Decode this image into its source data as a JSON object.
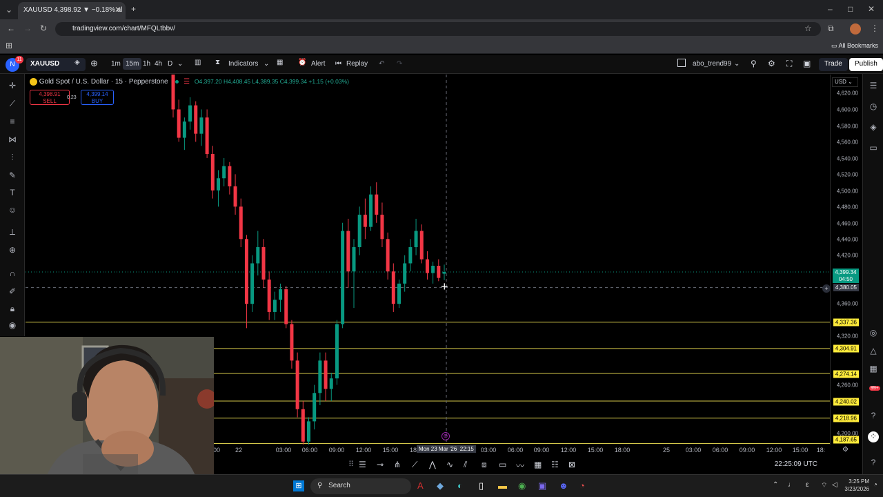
{
  "browser": {
    "tab_title": "XAUUSD 4,398.92 ▼ −0.18% al",
    "url": "tradingview.com/chart/MFQLtbbv/",
    "bookmarks_label": "All Bookmarks"
  },
  "toolbar": {
    "avatar_letter": "N",
    "notif_count": "11",
    "symbol": "XAUUSD",
    "intervals": [
      "1m",
      "15m",
      "1h",
      "4h",
      "D"
    ],
    "active_interval": "15m",
    "indicators_label": "Indicators",
    "alert_label": "Alert",
    "replay_label": "Replay",
    "layout_name": "abo_trend99",
    "trade_label": "Trade",
    "publish_label": "Publish"
  },
  "legend": {
    "title": "Gold Spot / U.S. Dollar · 15 · Pepperstone",
    "open": "O4,397.20",
    "high": "H4,408.45",
    "low": "L4,389.35",
    "close": "C4,399.34",
    "change": "+1.15 (+0.03%)",
    "sell_price": "4,398.91",
    "sell_label": "SELL",
    "spread": "0.23",
    "buy_price": "4,399.14",
    "buy_label": "BUY"
  },
  "price_axis": {
    "currency": "USD",
    "ticks": [
      "4,620.00",
      "4,600.00",
      "4,580.00",
      "4,560.00",
      "4,540.00",
      "4,520.00",
      "4,500.00",
      "4,480.00",
      "4,460.00",
      "4,440.00",
      "4,420.00",
      "4,360.00",
      "4,320.00",
      "4,260.00",
      "4,200.00"
    ],
    "current_price": "4,399.34",
    "countdown": "04:50",
    "crosshair_price": "4,380.05",
    "levels": [
      "4,337.36",
      "4,304.91",
      "4,274.14",
      "4,240.02",
      "4,218.96",
      "4,187.65"
    ]
  },
  "time_axis": {
    "labels": [
      "00",
      "22",
      "03:00",
      "06:00",
      "09:00",
      "12:00",
      "15:00",
      "18",
      "22:15",
      "03:00",
      "06:00",
      "09:00",
      "12:00",
      "15:00",
      "18:00",
      "25",
      "03:00",
      "06:00",
      "09:00",
      "12:00",
      "15:00",
      "18:"
    ],
    "crosshair_date": "Mon 23 Mar '26",
    "clock": "22:25:09 UTC"
  },
  "taskbar": {
    "search_label": "Search",
    "time": "3:25 PM",
    "date": "3/23/2026",
    "badge": "99+"
  },
  "chart_data": {
    "type": "candlestick",
    "symbol": "XAUUSD",
    "interval": "15",
    "ylim": [
      4180,
      4630
    ],
    "horizontal_levels": [
      4337.36,
      4304.91,
      4274.14,
      4240.02,
      4218.96,
      4187.65
    ],
    "last_price": 4399.34,
    "crosshair_price": 4380.05,
    "candles": [
      {
        "o": 4650,
        "h": 4655,
        "l": 4590,
        "c": 4600
      },
      {
        "o": 4600,
        "h": 4612,
        "l": 4560,
        "c": 4565
      },
      {
        "o": 4565,
        "h": 4590,
        "l": 4550,
        "c": 4585
      },
      {
        "o": 4585,
        "h": 4615,
        "l": 4575,
        "c": 4605
      },
      {
        "o": 4605,
        "h": 4610,
        "l": 4560,
        "c": 4570
      },
      {
        "o": 4570,
        "h": 4600,
        "l": 4555,
        "c": 4590
      },
      {
        "o": 4590,
        "h": 4600,
        "l": 4540,
        "c": 4545
      },
      {
        "o": 4545,
        "h": 4555,
        "l": 4490,
        "c": 4500
      },
      {
        "o": 4500,
        "h": 4525,
        "l": 4480,
        "c": 4515
      },
      {
        "o": 4515,
        "h": 4540,
        "l": 4505,
        "c": 4530
      },
      {
        "o": 4530,
        "h": 4535,
        "l": 4495,
        "c": 4505
      },
      {
        "o": 4505,
        "h": 4520,
        "l": 4470,
        "c": 4480
      },
      {
        "o": 4480,
        "h": 4490,
        "l": 4430,
        "c": 4440
      },
      {
        "o": 4440,
        "h": 4445,
        "l": 4330,
        "c": 4360
      },
      {
        "o": 4360,
        "h": 4420,
        "l": 4350,
        "c": 4410
      },
      {
        "o": 4410,
        "h": 4450,
        "l": 4395,
        "c": 4430
      },
      {
        "o": 4430,
        "h": 4440,
        "l": 4380,
        "c": 4390
      },
      {
        "o": 4390,
        "h": 4400,
        "l": 4340,
        "c": 4350
      },
      {
        "o": 4350,
        "h": 4375,
        "l": 4340,
        "c": 4365
      },
      {
        "o": 4365,
        "h": 4385,
        "l": 4350,
        "c": 4378
      },
      {
        "o": 4378,
        "h": 4382,
        "l": 4330,
        "c": 4335
      },
      {
        "o": 4335,
        "h": 4340,
        "l": 4280,
        "c": 4290
      },
      {
        "o": 4290,
        "h": 4300,
        "l": 4220,
        "c": 4230
      },
      {
        "o": 4230,
        "h": 4240,
        "l": 4180,
        "c": 4190
      },
      {
        "o": 4190,
        "h": 4220,
        "l": 4180,
        "c": 4215
      },
      {
        "o": 4215,
        "h": 4260,
        "l": 4205,
        "c": 4250
      },
      {
        "o": 4250,
        "h": 4300,
        "l": 4235,
        "c": 4290
      },
      {
        "o": 4290,
        "h": 4300,
        "l": 4240,
        "c": 4255
      },
      {
        "o": 4255,
        "h": 4275,
        "l": 4240,
        "c": 4268
      },
      {
        "o": 4268,
        "h": 4340,
        "l": 4260,
        "c": 4335
      },
      {
        "o": 4335,
        "h": 4460,
        "l": 4330,
        "c": 4450
      },
      {
        "o": 4450,
        "h": 4465,
        "l": 4380,
        "c": 4400
      },
      {
        "o": 4400,
        "h": 4440,
        "l": 4355,
        "c": 4430
      },
      {
        "o": 4430,
        "h": 4480,
        "l": 4420,
        "c": 4470
      },
      {
        "o": 4470,
        "h": 4490,
        "l": 4440,
        "c": 4455
      },
      {
        "o": 4455,
        "h": 4505,
        "l": 4450,
        "c": 4495
      },
      {
        "o": 4495,
        "h": 4510,
        "l": 4460,
        "c": 4470
      },
      {
        "o": 4470,
        "h": 4485,
        "l": 4430,
        "c": 4440
      },
      {
        "o": 4440,
        "h": 4448,
        "l": 4390,
        "c": 4400
      },
      {
        "o": 4400,
        "h": 4410,
        "l": 4350,
        "c": 4360
      },
      {
        "o": 4360,
        "h": 4390,
        "l": 4355,
        "c": 4385
      },
      {
        "o": 4385,
        "h": 4420,
        "l": 4375,
        "c": 4410
      },
      {
        "o": 4410,
        "h": 4440,
        "l": 4400,
        "c": 4430
      },
      {
        "o": 4430,
        "h": 4465,
        "l": 4420,
        "c": 4450
      },
      {
        "o": 4450,
        "h": 4458,
        "l": 4410,
        "c": 4415
      },
      {
        "o": 4415,
        "h": 4425,
        "l": 4390,
        "c": 4398
      },
      {
        "o": 4398,
        "h": 4412,
        "l": 4385,
        "c": 4407
      },
      {
        "o": 4407,
        "h": 4415,
        "l": 4388,
        "c": 4392
      },
      {
        "o": 4397.2,
        "h": 4408.45,
        "l": 4389.35,
        "c": 4399.34
      }
    ]
  }
}
